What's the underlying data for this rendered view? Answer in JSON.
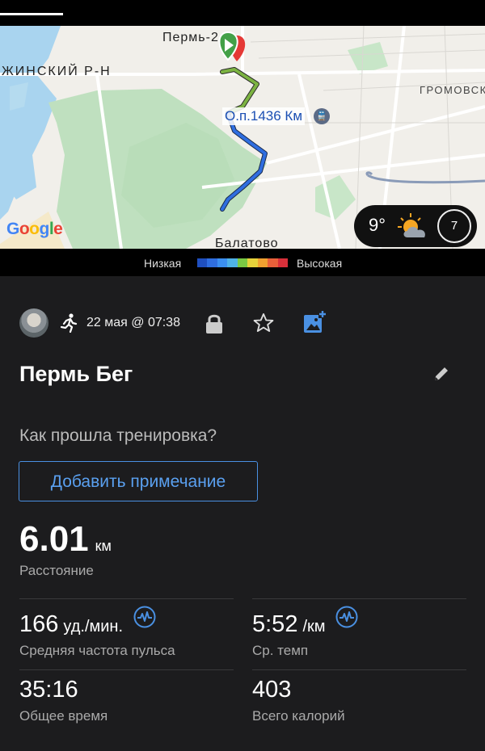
{
  "map": {
    "label_perm": "Пермь-2",
    "label_district": "ЖИНСКИЙ Р-Н",
    "label_gromovsk": "ГРОМОВСК",
    "label_station": "О.п.1436 Км",
    "label_balatovo": "Балатово",
    "google": [
      "G",
      "o",
      "o",
      "g",
      "l",
      "e"
    ]
  },
  "weather": {
    "temperature": "9°",
    "wind": "7",
    "icon": "partly-cloudy-icon"
  },
  "legend": {
    "low": "Низкая",
    "high": "Высокая",
    "colors": [
      "#1f4fbf",
      "#2f6ee0",
      "#3b8ff0",
      "#4fb2e6",
      "#7ac943",
      "#e6d23a",
      "#f0a030",
      "#e8603a",
      "#d8303a"
    ]
  },
  "activity": {
    "date": "22 мая @ 07:38",
    "title": "Пермь Бег",
    "question": "Как прошла тренировка?",
    "add_note": "Добавить примечание"
  },
  "distance": {
    "value": "6.01",
    "unit": "км",
    "label": "Расстояние"
  },
  "stats": {
    "heart_rate": {
      "value": "166",
      "unit": "уд./мин.",
      "label": "Средняя частота пульса"
    },
    "pace": {
      "value": "5:52",
      "unit": "/км",
      "label": "Ср. темп"
    },
    "time": {
      "value": "35:16",
      "label": "Общее время"
    },
    "calories": {
      "value": "403",
      "label": "Всего калорий"
    }
  },
  "colors": {
    "accent": "#4a90e2",
    "route_green": "#7cb342",
    "route_blue": "#2f6ee0"
  }
}
